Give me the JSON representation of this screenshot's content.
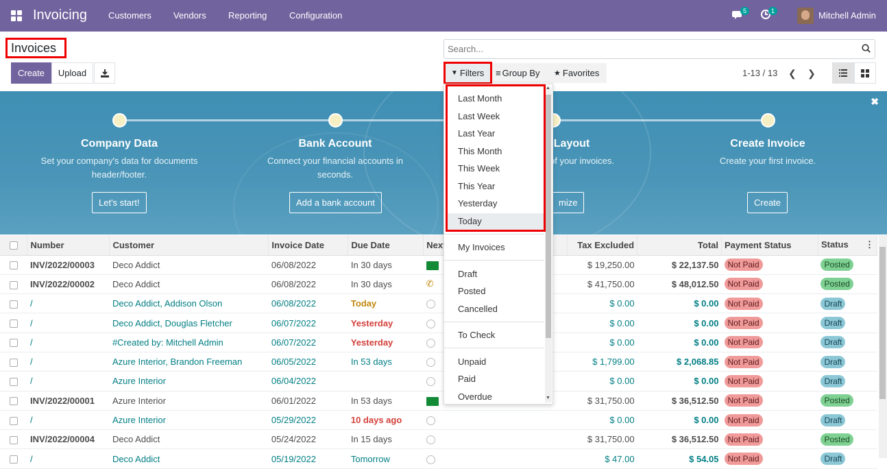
{
  "navbar": {
    "app_name": "Invoicing",
    "menu": [
      "Customers",
      "Vendors",
      "Reporting",
      "Configuration"
    ],
    "messages_count": "5",
    "activities_count": "1",
    "user": "Mitchell Admin"
  },
  "page": {
    "title": "Invoices",
    "create_label": "Create",
    "upload_label": "Upload",
    "search_placeholder": "Search...",
    "filters_label": "Filters",
    "groupby_label": "Group By",
    "favorites_label": "Favorites",
    "pager": "1-13 / 13"
  },
  "banner": {
    "steps": [
      {
        "title": "Company Data",
        "desc": "Set your company's data for documents header/footer.",
        "button": "Let's start!"
      },
      {
        "title": "Bank Account",
        "desc": "Connect your financial accounts in seconds.",
        "button": "Add a bank account"
      },
      {
        "title": "Layout",
        "desc": "k of your invoices.",
        "button": "mize"
      },
      {
        "title": "Create Invoice",
        "desc": "Create your first invoice.",
        "button": "Create"
      }
    ]
  },
  "filters_dropdown": {
    "date_filters": [
      "Last Month",
      "Last Week",
      "Last Year",
      "This Month",
      "This Week",
      "This Year",
      "Yesterday",
      "Today"
    ],
    "my": "My Invoices",
    "state": [
      "Draft",
      "Posted",
      "Cancelled"
    ],
    "check": "To Check",
    "payment": [
      "Unpaid",
      "Paid",
      "Overdue"
    ]
  },
  "table": {
    "columns": [
      "Number",
      "Customer",
      "Invoice Date",
      "Due Date",
      "Next",
      "Tax Excluded",
      "Total",
      "Payment Status",
      "Status"
    ],
    "rows": [
      {
        "number": "INV/2022/00003",
        "customer": "Deco Addict",
        "date": "06/08/2022",
        "due": "In 30 days",
        "activity": "green",
        "tax": "$ 19,250.00",
        "total": "$ 22,137.50",
        "payment": "Not Paid",
        "status": "Posted",
        "draft": false,
        "due_style": ""
      },
      {
        "number": "INV/2022/00002",
        "customer": "Deco Addict",
        "date": "06/08/2022",
        "due": "In 30 days",
        "activity": "phone",
        "tax": "$ 41,750.00",
        "total": "$ 48,012.50",
        "payment": "Not Paid",
        "status": "Posted",
        "draft": false,
        "due_style": ""
      },
      {
        "number": "/",
        "customer": "Deco Addict, Addison Olson",
        "date": "06/08/2022",
        "due": "Today",
        "activity": "clock",
        "tax": "$ 0.00",
        "total": "$ 0.00",
        "payment": "Not Paid",
        "status": "Draft",
        "draft": true,
        "due_style": "amber"
      },
      {
        "number": "/",
        "customer": "Deco Addict, Douglas Fletcher",
        "date": "06/07/2022",
        "due": "Yesterday",
        "activity": "clock",
        "tax": "$ 0.00",
        "total": "$ 0.00",
        "payment": "Not Paid",
        "status": "Draft",
        "draft": true,
        "due_style": "red"
      },
      {
        "number": "/",
        "customer": "#Created by: Mitchell Admin",
        "date": "06/07/2022",
        "due": "Yesterday",
        "activity": "clock",
        "tax": "$ 0.00",
        "total": "$ 0.00",
        "payment": "Not Paid",
        "status": "Draft",
        "draft": true,
        "due_style": "red"
      },
      {
        "number": "/",
        "customer": "Azure Interior, Brandon Freeman",
        "date": "06/05/2022",
        "due": "In 53 days",
        "activity": "clock",
        "tax": "$ 1,799.00",
        "total": "$ 2,068.85",
        "payment": "Not Paid",
        "status": "Draft",
        "draft": true,
        "due_style": ""
      },
      {
        "number": "/",
        "customer": "Azure Interior",
        "date": "06/04/2022",
        "due": "",
        "activity": "clock",
        "tax": "$ 0.00",
        "total": "$ 0.00",
        "payment": "Not Paid",
        "status": "Draft",
        "draft": true,
        "due_style": ""
      },
      {
        "number": "INV/2022/00001",
        "customer": "Azure Interior",
        "date": "06/01/2022",
        "due": "In 53 days",
        "activity": "green",
        "tax": "$ 31,750.00",
        "total": "$ 36,512.50",
        "payment": "Not Paid",
        "status": "Posted",
        "draft": false,
        "due_style": ""
      },
      {
        "number": "/",
        "customer": "Azure Interior",
        "date": "05/29/2022",
        "due": "10 days ago",
        "activity": "clock",
        "tax": "$ 0.00",
        "total": "$ 0.00",
        "payment": "Not Paid",
        "status": "Draft",
        "draft": true,
        "due_style": "red"
      },
      {
        "number": "INV/2022/00004",
        "customer": "Deco Addict",
        "date": "05/24/2022",
        "due": "In 15 days",
        "activity": "clock",
        "tax": "$ 31,750.00",
        "total": "$ 36,512.50",
        "payment": "Not Paid",
        "status": "Posted",
        "draft": false,
        "due_style": ""
      },
      {
        "number": "/",
        "customer": "Deco Addict",
        "date": "05/19/2022",
        "due": "Tomorrow",
        "activity": "clock",
        "tax": "$ 47.00",
        "total": "$ 54.05",
        "payment": "Not Paid",
        "status": "Draft",
        "draft": true,
        "due_style": ""
      }
    ]
  }
}
